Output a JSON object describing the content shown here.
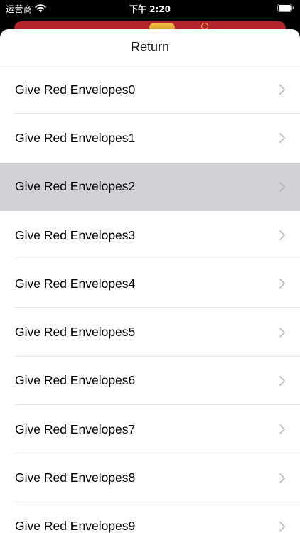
{
  "status_bar": {
    "carrier": "运营商",
    "time": "下午 2:20"
  },
  "sheet": {
    "title": "Return",
    "items": [
      {
        "label": "Give Red Envelopes0",
        "selected": false
      },
      {
        "label": "Give Red Envelopes1",
        "selected": false
      },
      {
        "label": "Give Red Envelopes2",
        "selected": true
      },
      {
        "label": "Give Red Envelopes3",
        "selected": false
      },
      {
        "label": "Give Red Envelopes4",
        "selected": false
      },
      {
        "label": "Give Red Envelopes5",
        "selected": false
      },
      {
        "label": "Give Red Envelopes6",
        "selected": false
      },
      {
        "label": "Give Red Envelopes7",
        "selected": false
      },
      {
        "label": "Give Red Envelopes8",
        "selected": false
      },
      {
        "label": "Give Red Envelopes9",
        "selected": false
      }
    ]
  },
  "colors": {
    "selected_row": "#d1d1d6",
    "chevron": "#c4c4c7",
    "behind_banner": "#b3252a"
  },
  "icons": {
    "wifi": "wifi-icon",
    "battery": "battery-icon",
    "chevron": "chevron-right-icon"
  }
}
